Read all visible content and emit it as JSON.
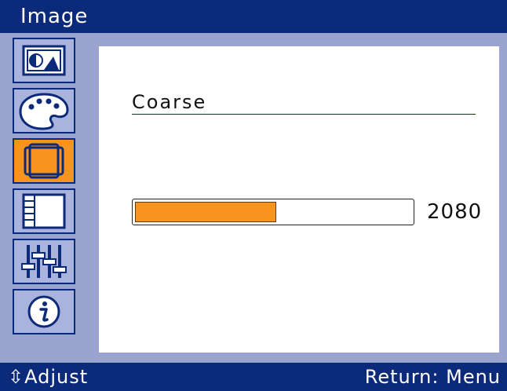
{
  "title": "Image",
  "sidebar": {
    "items": [
      {
        "icon": "brightness-contrast-icon",
        "active": false
      },
      {
        "icon": "color-palette-icon",
        "active": false
      },
      {
        "icon": "image-position-icon",
        "active": true
      },
      {
        "icon": "osd-menu-icon",
        "active": false
      },
      {
        "icon": "setup-sliders-icon",
        "active": false
      },
      {
        "icon": "information-icon",
        "active": false
      }
    ]
  },
  "content": {
    "label": "Coarse",
    "value": "2080",
    "level_percent": 51
  },
  "footer": {
    "left": "⇳Adjust",
    "right": "Return: Menu"
  },
  "colors": {
    "header": "#0c2a7a",
    "panel": "#9aa4cf",
    "accent": "#f7941d"
  }
}
